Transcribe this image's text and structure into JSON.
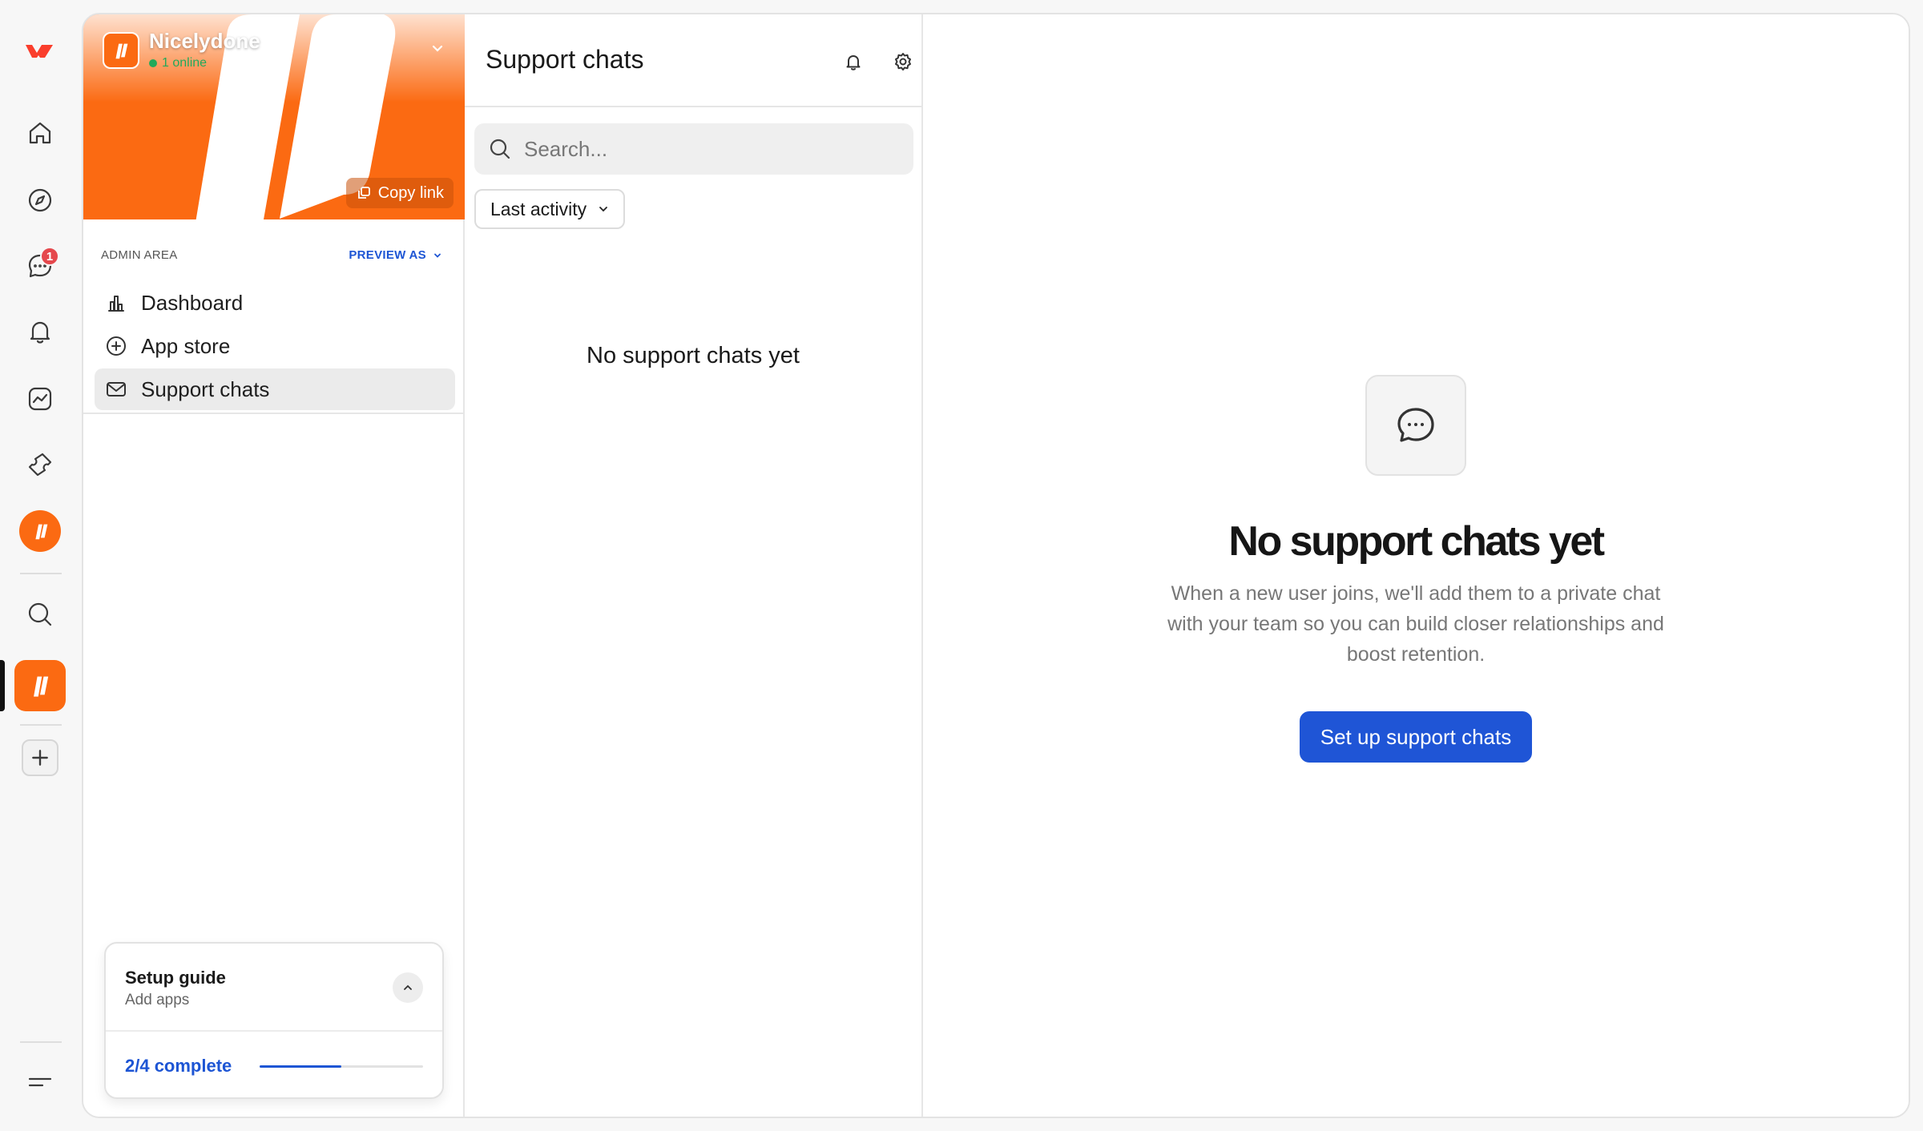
{
  "rail": {
    "items": [
      {
        "name": "home-icon"
      },
      {
        "name": "compass-icon"
      },
      {
        "name": "chat-icon",
        "badge": "1"
      },
      {
        "name": "bell-icon"
      },
      {
        "name": "activity-icon"
      },
      {
        "name": "ticket-icon"
      },
      {
        "name": "search-icon"
      }
    ],
    "accent": "#fb6a12"
  },
  "workspace": {
    "name": "Nicelydone",
    "online": "1 online",
    "copy_link": "Copy link"
  },
  "sidebar": {
    "admin_label": "ADMIN AREA",
    "preview_as": "PREVIEW AS",
    "items": [
      {
        "label": "Dashboard",
        "icon": "bar-chart-icon"
      },
      {
        "label": "App store",
        "icon": "plus-circle-icon"
      },
      {
        "label": "Support chats",
        "icon": "mail-icon",
        "active": true
      }
    ]
  },
  "setup_guide": {
    "title": "Setup guide",
    "subtitle": "Add apps",
    "progress_text": "2/4 complete",
    "progress": 0.5
  },
  "chat_list": {
    "title": "Support chats",
    "search_placeholder": "Search...",
    "sort_label": "Last activity",
    "empty_text": "No support chats yet"
  },
  "main": {
    "empty_title": "No support chats yet",
    "empty_description": "When a new user joins, we'll add them to a private chat with your team so you can build closer relationships and boost retention.",
    "cta_label": "Set up support chats",
    "cta_color": "#1f55d6"
  }
}
